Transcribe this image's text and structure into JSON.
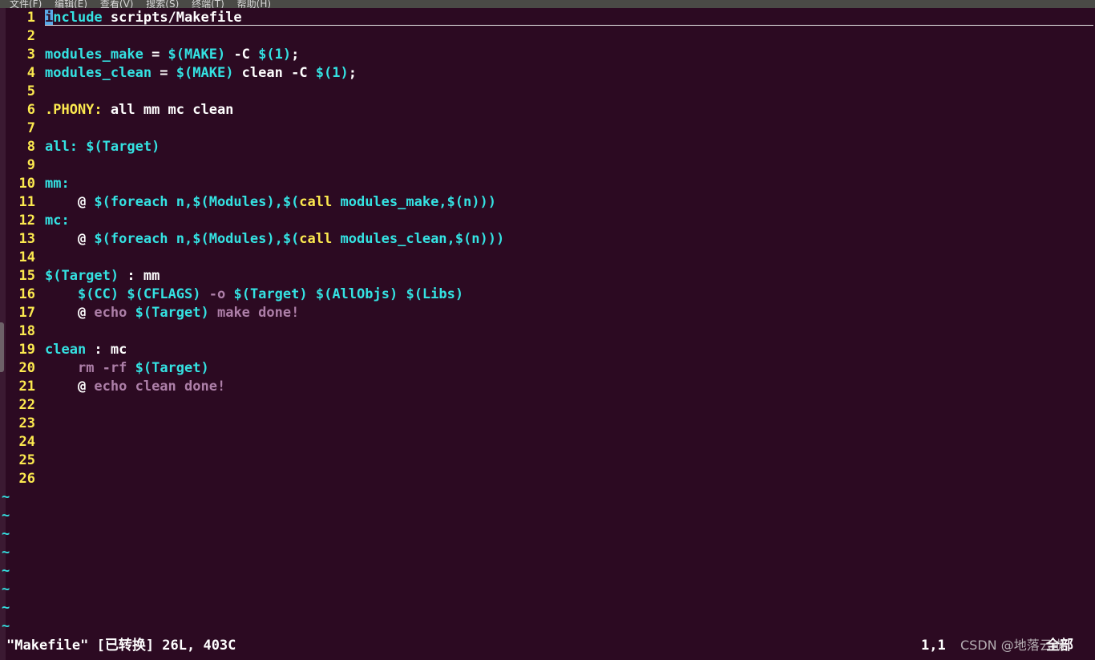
{
  "colors": {
    "background": "#2c0a22",
    "line_number": "#fce94f",
    "keyword_cyan": "#34e2e2",
    "special_yellow": "#fce94f",
    "shell_purple": "#ad7fa8",
    "plain": "#ffffff",
    "cursor": "#5aa9e6"
  },
  "menubar": {
    "items": [
      "文件(F)",
      "编辑(E)",
      "查看(V)",
      "搜索(S)",
      "终端(T)",
      "帮助(H)"
    ]
  },
  "editor": {
    "cursor_char": "i",
    "lines": [
      {
        "num": "1",
        "segments": [
          {
            "text": "nclude",
            "c": "kw"
          },
          {
            "text": " scripts/Makefile",
            "c": "plain"
          }
        ]
      },
      {
        "num": "2",
        "segments": []
      },
      {
        "num": "3",
        "segments": [
          {
            "text": "modules_make",
            "c": "kw"
          },
          {
            "text": " = ",
            "c": "plain"
          },
          {
            "text": "$(MAKE)",
            "c": "kw"
          },
          {
            "text": " -C ",
            "c": "plain"
          },
          {
            "text": "$(1)",
            "c": "kw"
          },
          {
            "text": ";",
            "c": "plain"
          }
        ]
      },
      {
        "num": "4",
        "segments": [
          {
            "text": "modules_clean",
            "c": "kw"
          },
          {
            "text": " = ",
            "c": "plain"
          },
          {
            "text": "$(MAKE)",
            "c": "kw"
          },
          {
            "text": " clean -C ",
            "c": "plain"
          },
          {
            "text": "$(1)",
            "c": "kw"
          },
          {
            "text": ";",
            "c": "plain"
          }
        ]
      },
      {
        "num": "5",
        "segments": []
      },
      {
        "num": "6",
        "segments": [
          {
            "text": ".PHONY:",
            "c": "sp"
          },
          {
            "text": " all mm mc clean",
            "c": "plain"
          }
        ]
      },
      {
        "num": "7",
        "segments": []
      },
      {
        "num": "8",
        "segments": [
          {
            "text": "all:",
            "c": "kw"
          },
          {
            "text": " ",
            "c": "plain"
          },
          {
            "text": "$(Target)",
            "c": "kw"
          }
        ]
      },
      {
        "num": "9",
        "segments": []
      },
      {
        "num": "10",
        "segments": [
          {
            "text": "mm:",
            "c": "kw"
          }
        ]
      },
      {
        "num": "11",
        "segments": [
          {
            "text": "    @ ",
            "c": "plain"
          },
          {
            "text": "$(foreach n,$(Modules),$(",
            "c": "kw"
          },
          {
            "text": "call",
            "c": "sp"
          },
          {
            "text": " modules_make,$(n)))",
            "c": "kw"
          }
        ]
      },
      {
        "num": "12",
        "segments": [
          {
            "text": "mc:",
            "c": "kw"
          }
        ]
      },
      {
        "num": "13",
        "segments": [
          {
            "text": "    @ ",
            "c": "plain"
          },
          {
            "text": "$(foreach n,$(Modules),$(",
            "c": "kw"
          },
          {
            "text": "call",
            "c": "sp"
          },
          {
            "text": " modules_clean,$(n)))",
            "c": "kw"
          }
        ]
      },
      {
        "num": "14",
        "segments": []
      },
      {
        "num": "15",
        "segments": [
          {
            "text": "$(Target)",
            "c": "kw"
          },
          {
            "text": " : mm",
            "c": "plain"
          }
        ]
      },
      {
        "num": "16",
        "segments": [
          {
            "text": "    ",
            "c": "plain"
          },
          {
            "text": "$(CC)",
            "c": "kw"
          },
          {
            "text": " ",
            "c": "plain"
          },
          {
            "text": "$(CFLAGS)",
            "c": "kw"
          },
          {
            "text": " -o ",
            "c": "sh"
          },
          {
            "text": "$(Target)",
            "c": "kw"
          },
          {
            "text": " ",
            "c": "plain"
          },
          {
            "text": "$(AllObjs)",
            "c": "kw"
          },
          {
            "text": " ",
            "c": "plain"
          },
          {
            "text": "$(Libs)",
            "c": "kw"
          }
        ]
      },
      {
        "num": "17",
        "segments": [
          {
            "text": "    @ ",
            "c": "plain"
          },
          {
            "text": "echo ",
            "c": "sh"
          },
          {
            "text": "$(Target)",
            "c": "kw"
          },
          {
            "text": " make done!",
            "c": "sh"
          }
        ]
      },
      {
        "num": "18",
        "segments": []
      },
      {
        "num": "19",
        "segments": [
          {
            "text": "clean",
            "c": "kw"
          },
          {
            "text": " : mc",
            "c": "plain"
          }
        ]
      },
      {
        "num": "20",
        "segments": [
          {
            "text": "    ",
            "c": "plain"
          },
          {
            "text": "rm -rf ",
            "c": "sh"
          },
          {
            "text": "$(Target)",
            "c": "kw"
          }
        ]
      },
      {
        "num": "21",
        "segments": [
          {
            "text": "    @ ",
            "c": "plain"
          },
          {
            "text": "echo clean done!",
            "c": "sh"
          }
        ]
      },
      {
        "num": "22",
        "segments": []
      },
      {
        "num": "23",
        "segments": []
      },
      {
        "num": "24",
        "segments": []
      },
      {
        "num": "25",
        "segments": []
      },
      {
        "num": "26",
        "segments": []
      }
    ],
    "tildes": [
      "~",
      "~",
      "~",
      "~",
      "~",
      "~",
      "~",
      "~"
    ]
  },
  "statusbar": {
    "file_info": "\"Makefile\" [已转换] 26L, 403C",
    "position": "1,1",
    "scroll": "全部"
  },
  "watermark": "CSDN @地落云崩"
}
